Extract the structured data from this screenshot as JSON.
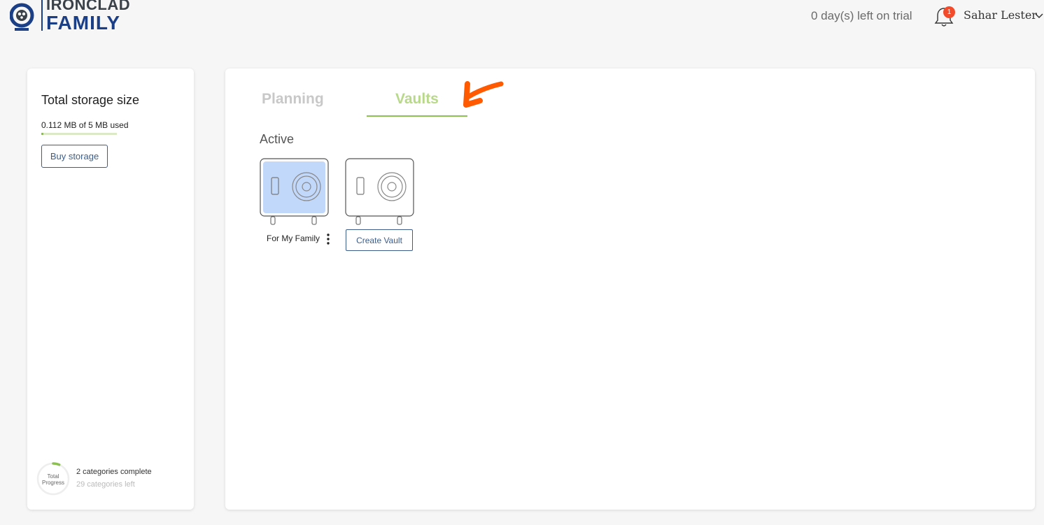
{
  "header": {
    "logo_line1": "IRONCLAD",
    "logo_line2": "FAMILY",
    "trial_text": "0 day(s) left on trial",
    "notification_count": "1",
    "user_name": "Sahar Lester"
  },
  "sidebar": {
    "storage_title": "Total storage size",
    "storage_used": "0.112 MB of 5 MB used",
    "storage_fraction": 0.0224,
    "buy_label": "Buy storage",
    "progress_label_line1": "Total",
    "progress_label_line2": "Progress",
    "categories_complete": "2 categories complete",
    "categories_left": "29 categories left"
  },
  "main": {
    "tabs": [
      {
        "label": "Planning",
        "active": false
      },
      {
        "label": "Vaults",
        "active": true
      }
    ],
    "section_label": "Active",
    "vaults": [
      {
        "name": "For My Family"
      }
    ],
    "create_label": "Create Vault"
  },
  "colors": {
    "accent_green": "#8cc152",
    "brand_blue": "#1b3f86",
    "button_blue": "#3c5d8a",
    "badge_red": "#f24b2c",
    "annotation_orange": "#ff5a00",
    "vault_selected": "#c2d8fb"
  }
}
